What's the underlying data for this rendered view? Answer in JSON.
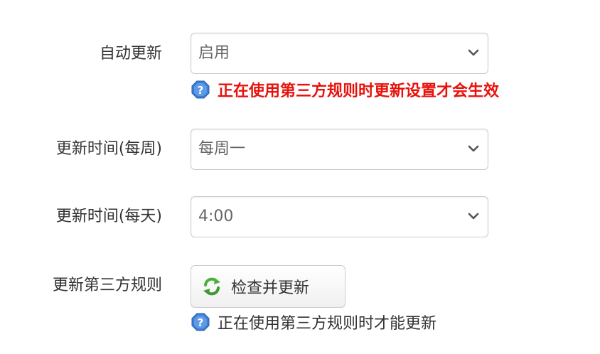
{
  "auto_update": {
    "label": "自动更新",
    "value": "启用",
    "hint": "正在使用第三方规则时更新设置才会生效"
  },
  "update_weekly": {
    "label": "更新时间(每周)",
    "value": "每周一"
  },
  "update_daily": {
    "label": "更新时间(每天)",
    "value": "4:00"
  },
  "update_third_party": {
    "label": "更新第三方规则",
    "button_label": "检查并更新",
    "hint": "正在使用第三方规则时才能更新"
  },
  "colors": {
    "warning_text": "#e8120c",
    "hint_icon": "#3b7fd4",
    "refresh_icon": "#4caf3c"
  },
  "icons": {
    "hint": "question-icon",
    "dropdown": "chevron-down-icon",
    "button": "refresh-icon"
  }
}
